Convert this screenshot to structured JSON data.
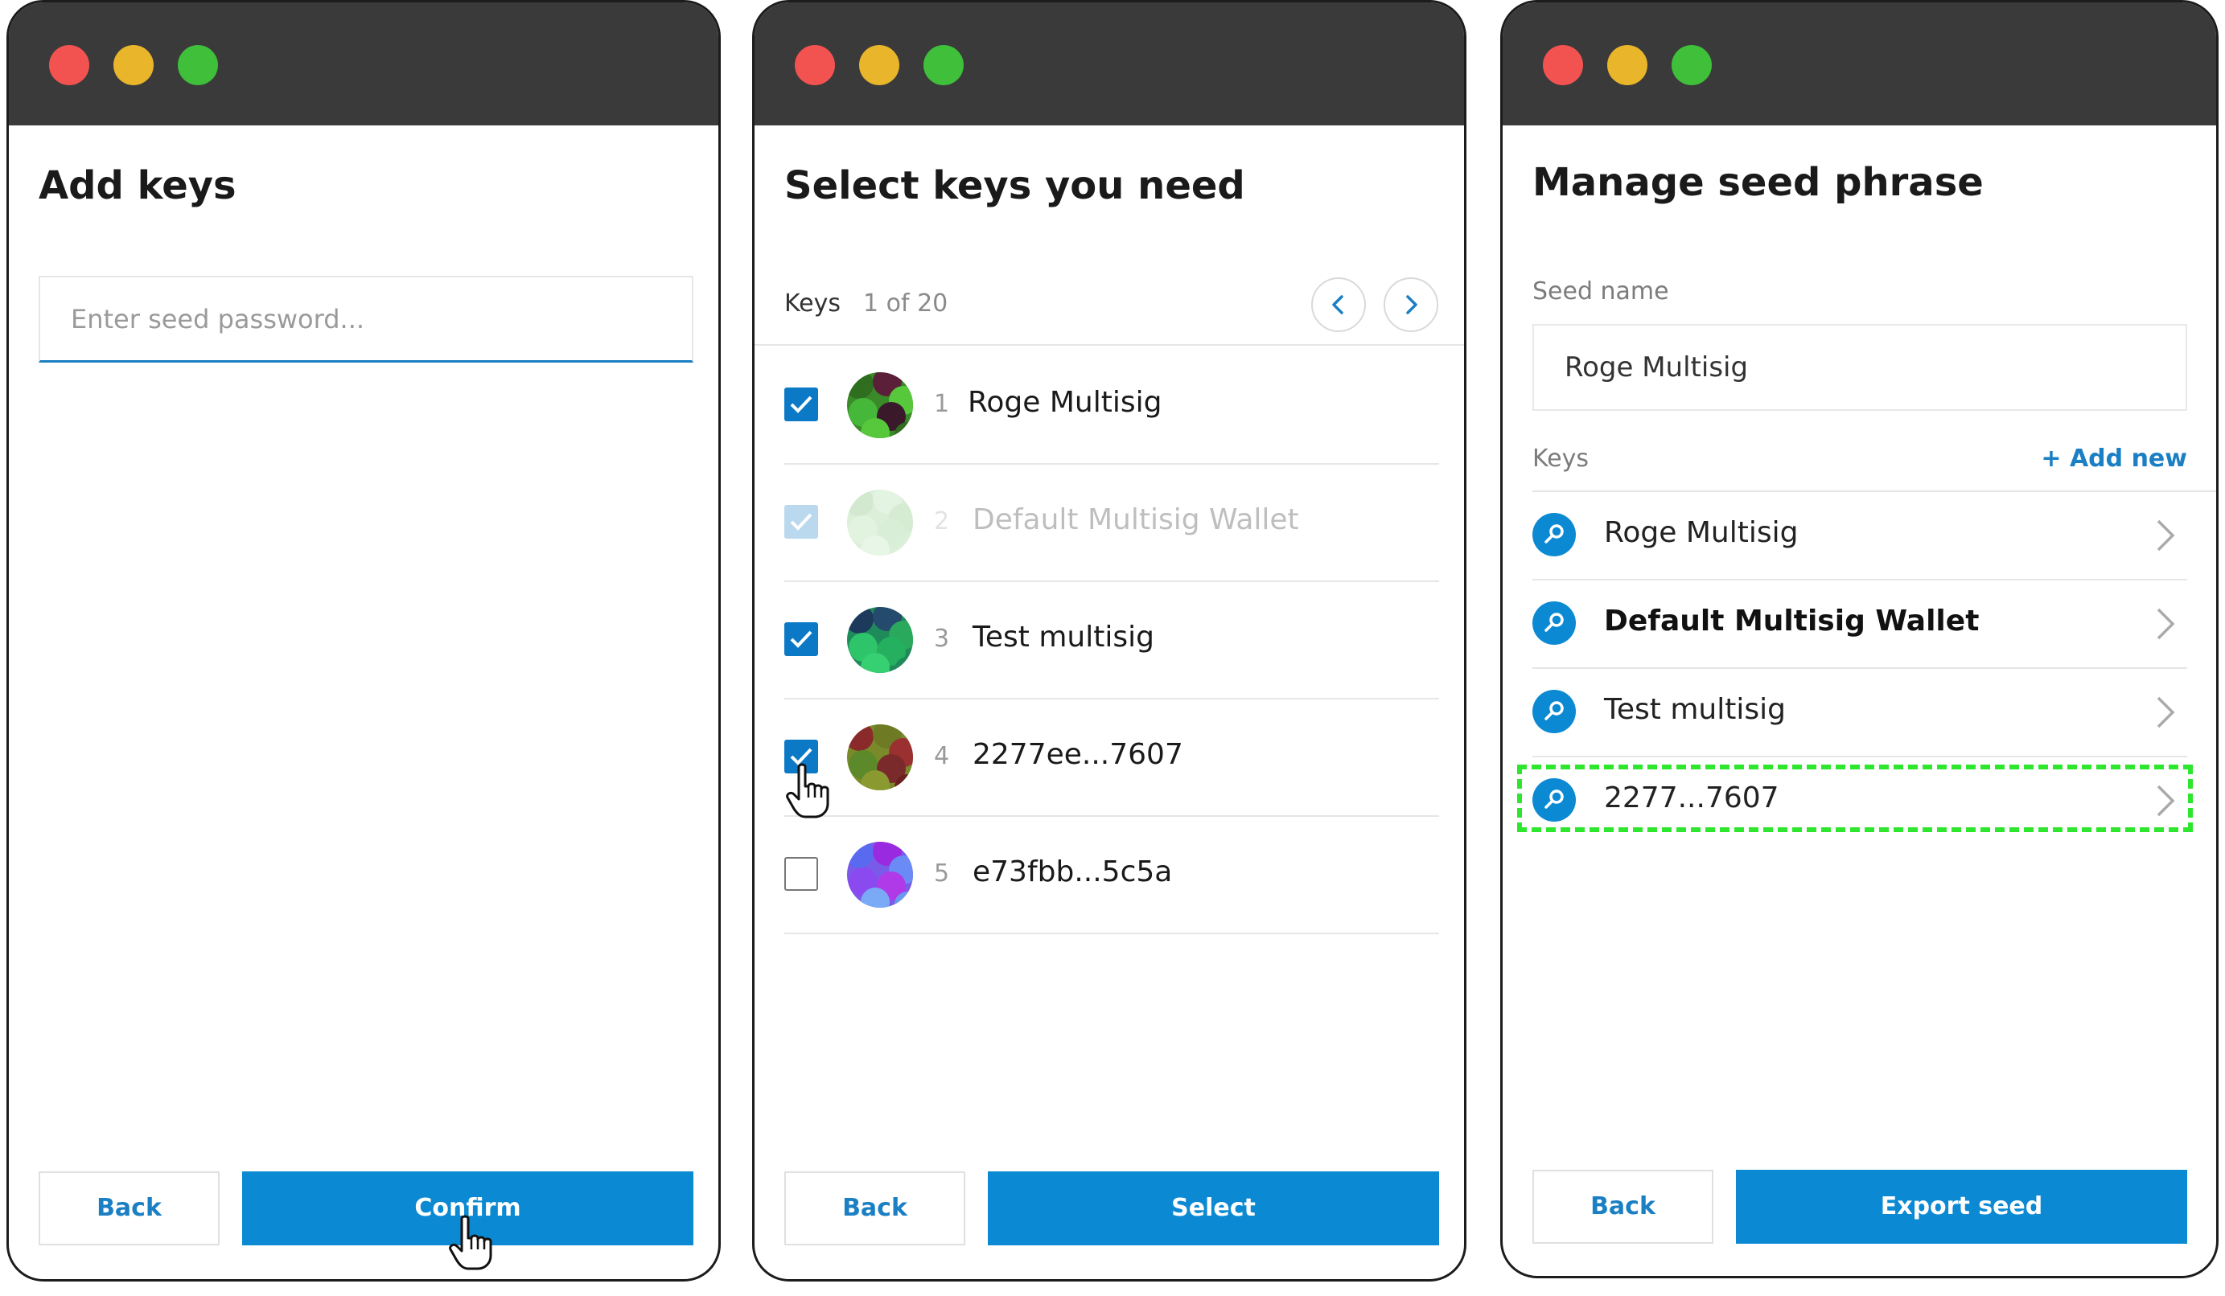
{
  "windows": {
    "add_keys": {
      "title": "Add keys",
      "password_placeholder": "Enter seed password...",
      "back_label": "Back",
      "confirm_label": "Confirm"
    },
    "select_keys": {
      "title": "Select keys you need",
      "keys_label": "Keys",
      "pagination": "1 of 20",
      "items": [
        {
          "index": "1",
          "name": "Roge Multisig",
          "checked": true,
          "disabled": false
        },
        {
          "index": "2",
          "name": "Default Multisig Wallet",
          "checked": true,
          "disabled": true
        },
        {
          "index": "3",
          "name": "Test multisig",
          "checked": true,
          "disabled": false
        },
        {
          "index": "4",
          "name": "2277ee...7607",
          "checked": true,
          "disabled": false
        },
        {
          "index": "5",
          "name": "e73fbb...5c5a",
          "checked": false,
          "disabled": false
        }
      ],
      "back_label": "Back",
      "select_label": "Select"
    },
    "manage_seed": {
      "title": "Manage seed phrase",
      "seed_name_label": "Seed name",
      "seed_name_value": "Roge Multisig",
      "keys_label": "Keys",
      "add_new_label": "+ Add new",
      "keys": [
        {
          "name": "Roge Multisig",
          "bold": false
        },
        {
          "name": "Default Multisig Wallet",
          "bold": true
        },
        {
          "name": "Test multisig",
          "bold": false
        },
        {
          "name": "2277...7607",
          "bold": false
        }
      ],
      "back_label": "Back",
      "export_label": "Export seed"
    }
  },
  "colors": {
    "accent": "#0b8ad3",
    "titlebar": "#3a3a3a",
    "highlight": "#2ee62e",
    "traffic_red": "#f25350",
    "traffic_yellow": "#e9b52b",
    "traffic_green": "#3fbf3a"
  }
}
